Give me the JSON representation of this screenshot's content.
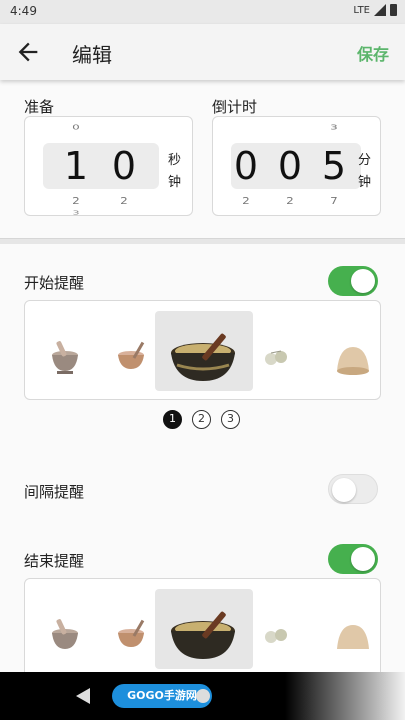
{
  "status": {
    "time": "4:49",
    "network": "LTE"
  },
  "app_bar": {
    "title": "编辑",
    "save_label": "保存"
  },
  "prepare": {
    "label": "准备",
    "digits": [
      {
        "main": "1",
        "up": "0",
        "down": "2",
        "down2": "3"
      },
      {
        "main": "0",
        "up": "",
        "down": "2",
        "down2": ""
      }
    ],
    "unit_top": "秒",
    "unit_bottom": "钟"
  },
  "countdown": {
    "label": "倒计时",
    "digits": [
      {
        "main": "0",
        "up": "",
        "down": "2",
        "down2": ""
      },
      {
        "main": "0",
        "up": "",
        "down": "2",
        "down2": ""
      },
      {
        "main": "5",
        "up": "3",
        "down": "7",
        "down2": ""
      }
    ],
    "unit_top": "分",
    "unit_bottom": "钟"
  },
  "start_reminder": {
    "label": "开始提醒",
    "enabled": true
  },
  "interval_reminder": {
    "label": "间隔提醒",
    "enabled": false
  },
  "end_reminder": {
    "label": "结束提醒",
    "enabled": true
  },
  "pagination": [
    "1",
    "2",
    "3"
  ],
  "watermark": "GOGO手游网"
}
